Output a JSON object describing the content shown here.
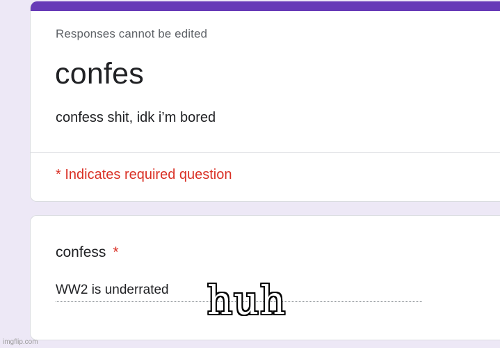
{
  "colors": {
    "background": "#ede8f6",
    "accent": "#673ab7",
    "required": "#d93025"
  },
  "form": {
    "notice": "Responses cannot be edited",
    "title": "confes",
    "description": "confess shit, idk i’m bored",
    "required_note": "* Indicates required question"
  },
  "question": {
    "title": "confess",
    "required_marker": "*",
    "answer": "WW2 is underrated"
  },
  "overlay": {
    "caption": "huh"
  },
  "watermark": "imgflip.com"
}
